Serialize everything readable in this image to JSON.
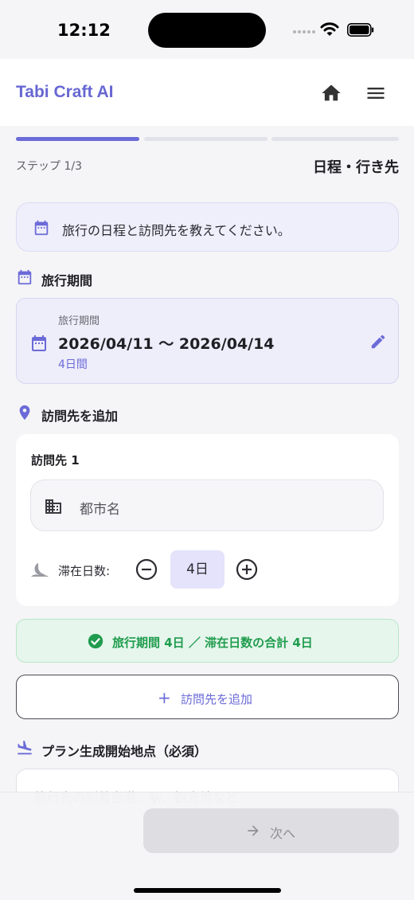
{
  "status_bar": {
    "time": "12:12"
  },
  "header": {
    "app_title": "Tabi Craft AI",
    "home_icon": "home-icon",
    "menu_icon": "menu-icon"
  },
  "progress": {
    "current_step": 1,
    "total_steps": 3,
    "active_color": "#6b6bd8"
  },
  "step": {
    "label": "ステップ 1/3",
    "title": "日程・行き先"
  },
  "info": {
    "message": "旅行の日程と訪問先を教えてください。"
  },
  "period_section": {
    "heading": "旅行期間",
    "card": {
      "caption": "旅行期間",
      "range": "2026/04/11 〜 2026/04/14",
      "days": "4日間"
    }
  },
  "destination_section": {
    "heading": "訪問先を追加",
    "destinations": [
      {
        "title": "訪問先 1",
        "city_placeholder": "都市名",
        "stay_label": "滞在日数:",
        "stay_value": "4日"
      }
    ]
  },
  "summary": {
    "text": "旅行期間 4日 ／ 滞在日数の合計 4日",
    "color": "#1f9c4d"
  },
  "add_destination": {
    "label": "訪問先を追加"
  },
  "start_point_section": {
    "heading": "プラン生成開始地点（必須）",
    "placeholder": "旅行先の到着空港、駅、観光地など"
  },
  "footer": {
    "next_label": "次へ"
  }
}
